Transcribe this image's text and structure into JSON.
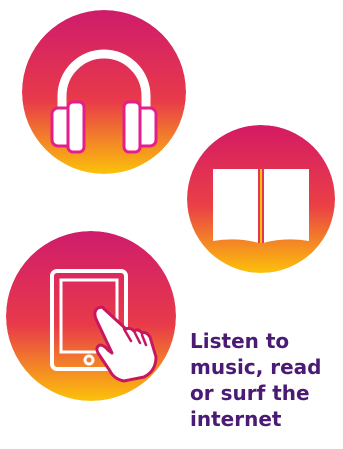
{
  "icons": [
    {
      "name": "headphones-icon"
    },
    {
      "name": "open-book-icon"
    },
    {
      "name": "tablet-touch-icon"
    }
  ],
  "colors": {
    "gradient_top": "#d6195f",
    "gradient_mid": "#f0483c",
    "gradient_bottom": "#fcc10a",
    "accent_magenta": "#e61e8c",
    "caption_text": "#4a1a74"
  },
  "caption": {
    "line1": "Listen to",
    "line2": "music, read",
    "line3": "or surf the",
    "line4": "internet"
  }
}
